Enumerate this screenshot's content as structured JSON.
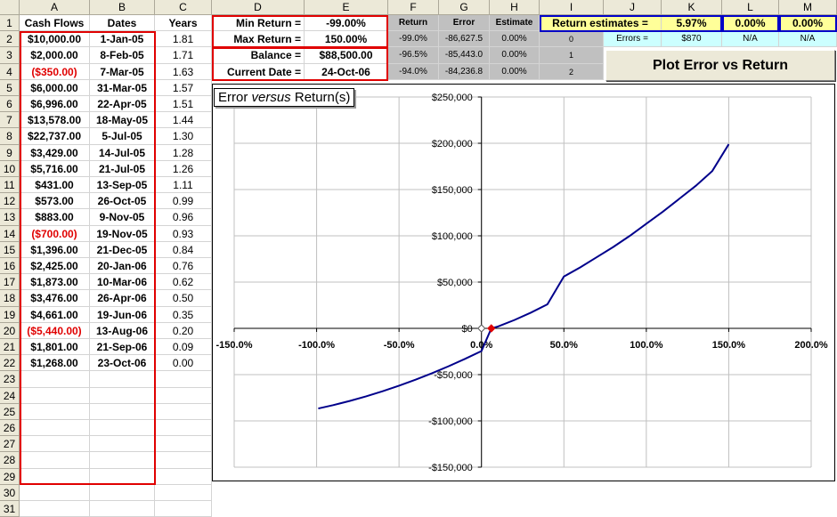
{
  "columns": [
    "A",
    "B",
    "C",
    "D",
    "E",
    "F",
    "G",
    "H",
    "I",
    "J",
    "K",
    "L",
    "M"
  ],
  "rows": [
    "1",
    "2",
    "3",
    "4",
    "5",
    "6",
    "7",
    "8",
    "9",
    "10",
    "11",
    "12",
    "13",
    "14",
    "15",
    "16",
    "17",
    "18",
    "19",
    "20",
    "21",
    "22",
    "23",
    "24",
    "25",
    "26",
    "27",
    "28",
    "29",
    "30",
    "31"
  ],
  "headers": {
    "a": "Cash Flows",
    "b": "Dates",
    "c": "Years"
  },
  "cashflows": [
    {
      "amount": "$10,000.00",
      "date": "1-Jan-05",
      "years": "1.81",
      "neg": false
    },
    {
      "amount": "$2,000.00",
      "date": "8-Feb-05",
      "years": "1.71",
      "neg": false
    },
    {
      "amount": "($350.00)",
      "date": "7-Mar-05",
      "years": "1.63",
      "neg": true
    },
    {
      "amount": "$6,000.00",
      "date": "31-Mar-05",
      "years": "1.57",
      "neg": false
    },
    {
      "amount": "$6,996.00",
      "date": "22-Apr-05",
      "years": "1.51",
      "neg": false
    },
    {
      "amount": "$13,578.00",
      "date": "18-May-05",
      "years": "1.44",
      "neg": false
    },
    {
      "amount": "$22,737.00",
      "date": "5-Jul-05",
      "years": "1.30",
      "neg": false
    },
    {
      "amount": "$3,429.00",
      "date": "14-Jul-05",
      "years": "1.28",
      "neg": false
    },
    {
      "amount": "$5,716.00",
      "date": "21-Jul-05",
      "years": "1.26",
      "neg": false
    },
    {
      "amount": "$431.00",
      "date": "13-Sep-05",
      "years": "1.11",
      "neg": false
    },
    {
      "amount": "$573.00",
      "date": "26-Oct-05",
      "years": "0.99",
      "neg": false
    },
    {
      "amount": "$883.00",
      "date": "9-Nov-05",
      "years": "0.96",
      "neg": false
    },
    {
      "amount": "($700.00)",
      "date": "19-Nov-05",
      "years": "0.93",
      "neg": true
    },
    {
      "amount": "$1,396.00",
      "date": "21-Dec-05",
      "years": "0.84",
      "neg": false
    },
    {
      "amount": "$2,425.00",
      "date": "20-Jan-06",
      "years": "0.76",
      "neg": false
    },
    {
      "amount": "$1,873.00",
      "date": "10-Mar-06",
      "years": "0.62",
      "neg": false
    },
    {
      "amount": "$3,476.00",
      "date": "26-Apr-06",
      "years": "0.50",
      "neg": false
    },
    {
      "amount": "$4,661.00",
      "date": "19-Jun-06",
      "years": "0.35",
      "neg": false
    },
    {
      "amount": "($5,440.00)",
      "date": "13-Aug-06",
      "years": "0.20",
      "neg": true
    },
    {
      "amount": "$1,801.00",
      "date": "21-Sep-06",
      "years": "0.09",
      "neg": false
    },
    {
      "amount": "$1,268.00",
      "date": "23-Oct-06",
      "years": "0.00",
      "neg": false
    }
  ],
  "params": {
    "min_return_label": "Min Return =",
    "min_return": "-99.00%",
    "max_return_label": "Max Return =",
    "max_return": "150.00%",
    "balance_label": "Balance =",
    "balance": "$88,500.00",
    "current_date_label": "Current Date =",
    "current_date": "24-Oct-06"
  },
  "table": {
    "h_return": "Return",
    "h_error": "Error",
    "h_estimate": "Estimate",
    "rows": [
      {
        "ret": "-99.0%",
        "err": "-86,627.5",
        "est": "0.00%",
        "idx": "0"
      },
      {
        "ret": "-96.5%",
        "err": "-85,443.0",
        "est": "0.00%",
        "idx": "1"
      },
      {
        "ret": "-94.0%",
        "err": "-84,236.8",
        "est": "0.00%",
        "idx": "2"
      }
    ]
  },
  "estimates": {
    "label": "Return estimates =",
    "est1": "5.97%",
    "est2": "0.00%",
    "est3": "0.00%",
    "errors_label": "Errors =",
    "err1": "$870",
    "err2": "N/A",
    "err3": "N/A"
  },
  "plot_button": "Plot Error vs Return",
  "colors": {
    "red": "#e00000",
    "blue": "#0000c8",
    "series": "#00008b",
    "highlight": "#ffff99",
    "cyan": "#ccffff"
  },
  "chart_data": {
    "type": "line",
    "title": "Error versus Return(s)",
    "title_main": "Error ",
    "title_italic": "versus",
    "title_tail": " Return(s)",
    "xlim": [
      -150,
      200
    ],
    "ylim": [
      -150000,
      250000
    ],
    "x_ticks": [
      -150,
      -100,
      -50,
      0,
      50,
      100,
      150,
      200
    ],
    "x_tick_labels": [
      "-150.0%",
      "-100.0%",
      "-50.0%",
      "0.0%",
      "50.0%",
      "100.0%",
      "150.0%",
      "200.0%"
    ],
    "y_ticks": [
      -150000,
      -100000,
      -50000,
      0,
      50000,
      100000,
      150000,
      200000,
      250000
    ],
    "y_tick_labels": [
      "-$150,000",
      "-$100,000",
      "-$50,000",
      "$0",
      "$50,000",
      "$100,000",
      "$150,000",
      "$200,000",
      "$250,000"
    ],
    "grid": true,
    "series": [
      {
        "x": [
          -99,
          -90,
          -80,
          -70,
          -60,
          -50,
          -40,
          -30,
          -20,
          -10,
          0,
          6,
          10,
          20,
          30,
          40,
          50,
          60,
          70,
          80,
          90,
          100,
          110,
          120,
          130,
          140,
          150
        ],
        "y": [
          -86600,
          -83000,
          -78500,
          -73500,
          -68000,
          -62000,
          -55500,
          -48500,
          -41000,
          -33000,
          -24500,
          0,
          2000,
          9000,
          17000,
          26000,
          56000,
          66000,
          77000,
          88000,
          100000,
          113000,
          126000,
          140000,
          154000,
          170000,
          199000
        ]
      }
    ],
    "markers": [
      {
        "x": 0,
        "y": 0,
        "kind": "hollow-diamond"
      },
      {
        "x": 5.97,
        "y": 0,
        "kind": "red-diamond"
      }
    ]
  }
}
